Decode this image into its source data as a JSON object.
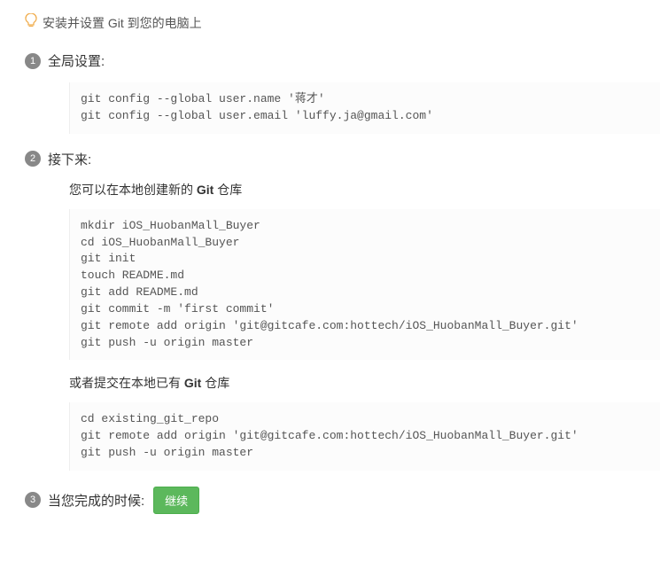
{
  "intro": "安装并设置 Git 到您的电脑上",
  "steps": {
    "one": {
      "num": "1",
      "title": "全局设置:",
      "code": "git config --global user.name '蒋才'\ngit config --global user.email 'luffy.ja@gmail.com'"
    },
    "two": {
      "num": "2",
      "title": "接下来:",
      "sub1_before": "您可以在本地创建新的 ",
      "sub1_bold": "Git",
      "sub1_after": " 仓库",
      "code1": "mkdir iOS_HuobanMall_Buyer\ncd iOS_HuobanMall_Buyer\ngit init\ntouch README.md\ngit add README.md\ngit commit -m 'first commit'\ngit remote add origin 'git@gitcafe.com:hottech/iOS_HuobanMall_Buyer.git'\ngit push -u origin master",
      "sub2_before": "或者提交在本地已有 ",
      "sub2_bold": "Git",
      "sub2_after": " 仓库",
      "code2": "cd existing_git_repo\ngit remote add origin 'git@gitcafe.com:hottech/iOS_HuobanMall_Buyer.git'\ngit push -u origin master"
    },
    "three": {
      "num": "3",
      "title": "当您完成的时候:",
      "button": "继续"
    }
  }
}
